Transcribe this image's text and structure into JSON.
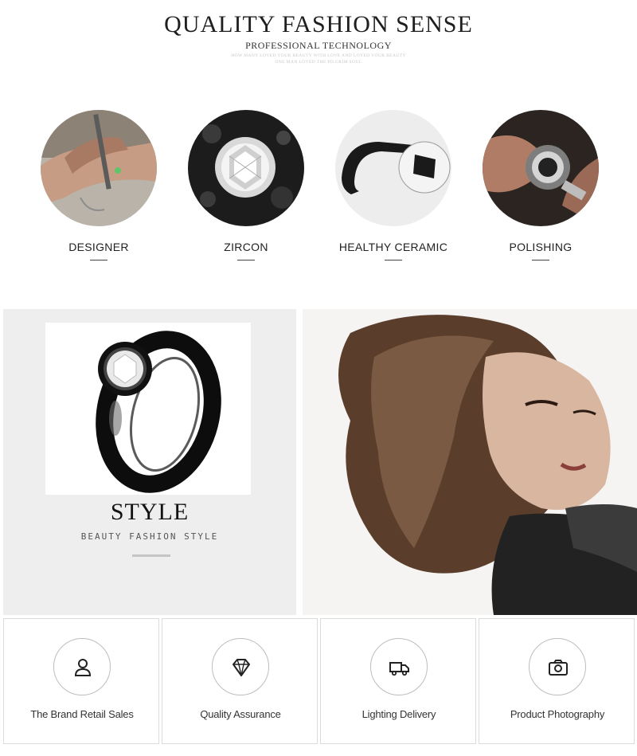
{
  "header": {
    "title": "QUALITY FASHION SENSE",
    "subtitle": "PROFESSIONAL TECHNOLOGY",
    "tagline_line1": "HOW MANY LOVED YOUR BEAUTY WITH LOVE AND LOVED YOUR BEAUTY",
    "tagline_line2": "ONE MAN LOVED THE PILGRIM SOUL"
  },
  "features": [
    {
      "label": "DESIGNER",
      "icon": "designer-photo"
    },
    {
      "label": "ZIRCON",
      "icon": "zircon-photo"
    },
    {
      "label": "HEALTHY CERAMIC",
      "icon": "ceramic-ring-photo"
    },
    {
      "label": "POLISHING",
      "icon": "polishing-photo"
    }
  ],
  "style_section": {
    "title": "STYLE",
    "subtitle": "BEAUTY FASHION STYLE"
  },
  "services": [
    {
      "label": "The Brand Retail Sales",
      "icon": "user-icon"
    },
    {
      "label": "Quality Assurance",
      "icon": "diamond-icon"
    },
    {
      "label": "Lighting Delivery",
      "icon": "truck-icon"
    },
    {
      "label": "Product Photography",
      "icon": "camera-icon"
    }
  ],
  "colors": {
    "text": "#222222",
    "panel": "#eeeeef",
    "card_border": "#dcdcdc"
  }
}
